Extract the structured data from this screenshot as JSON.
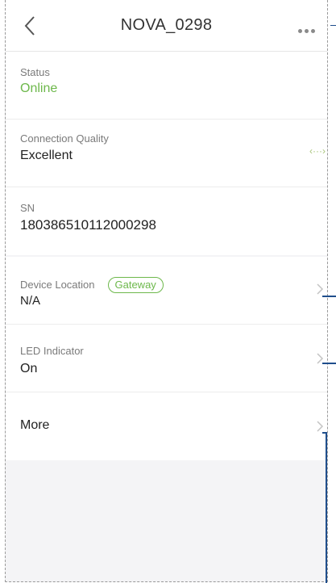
{
  "nav": {
    "title": "NOVA_0298"
  },
  "status": {
    "label": "Status",
    "value": "Online"
  },
  "connection": {
    "label": "Connection Quality",
    "value": "Excellent",
    "signal_glyph": "‹···›"
  },
  "sn": {
    "label": "SN",
    "value": "180386510112000298"
  },
  "location": {
    "label": "Device Location",
    "badge": "Gateway",
    "value": "N/A"
  },
  "led": {
    "label": "LED Indicator",
    "value": "On"
  },
  "more": {
    "label": "More"
  },
  "colors": {
    "accent_green": "#6db84b",
    "annotation_blue": "#1f4e8c"
  }
}
